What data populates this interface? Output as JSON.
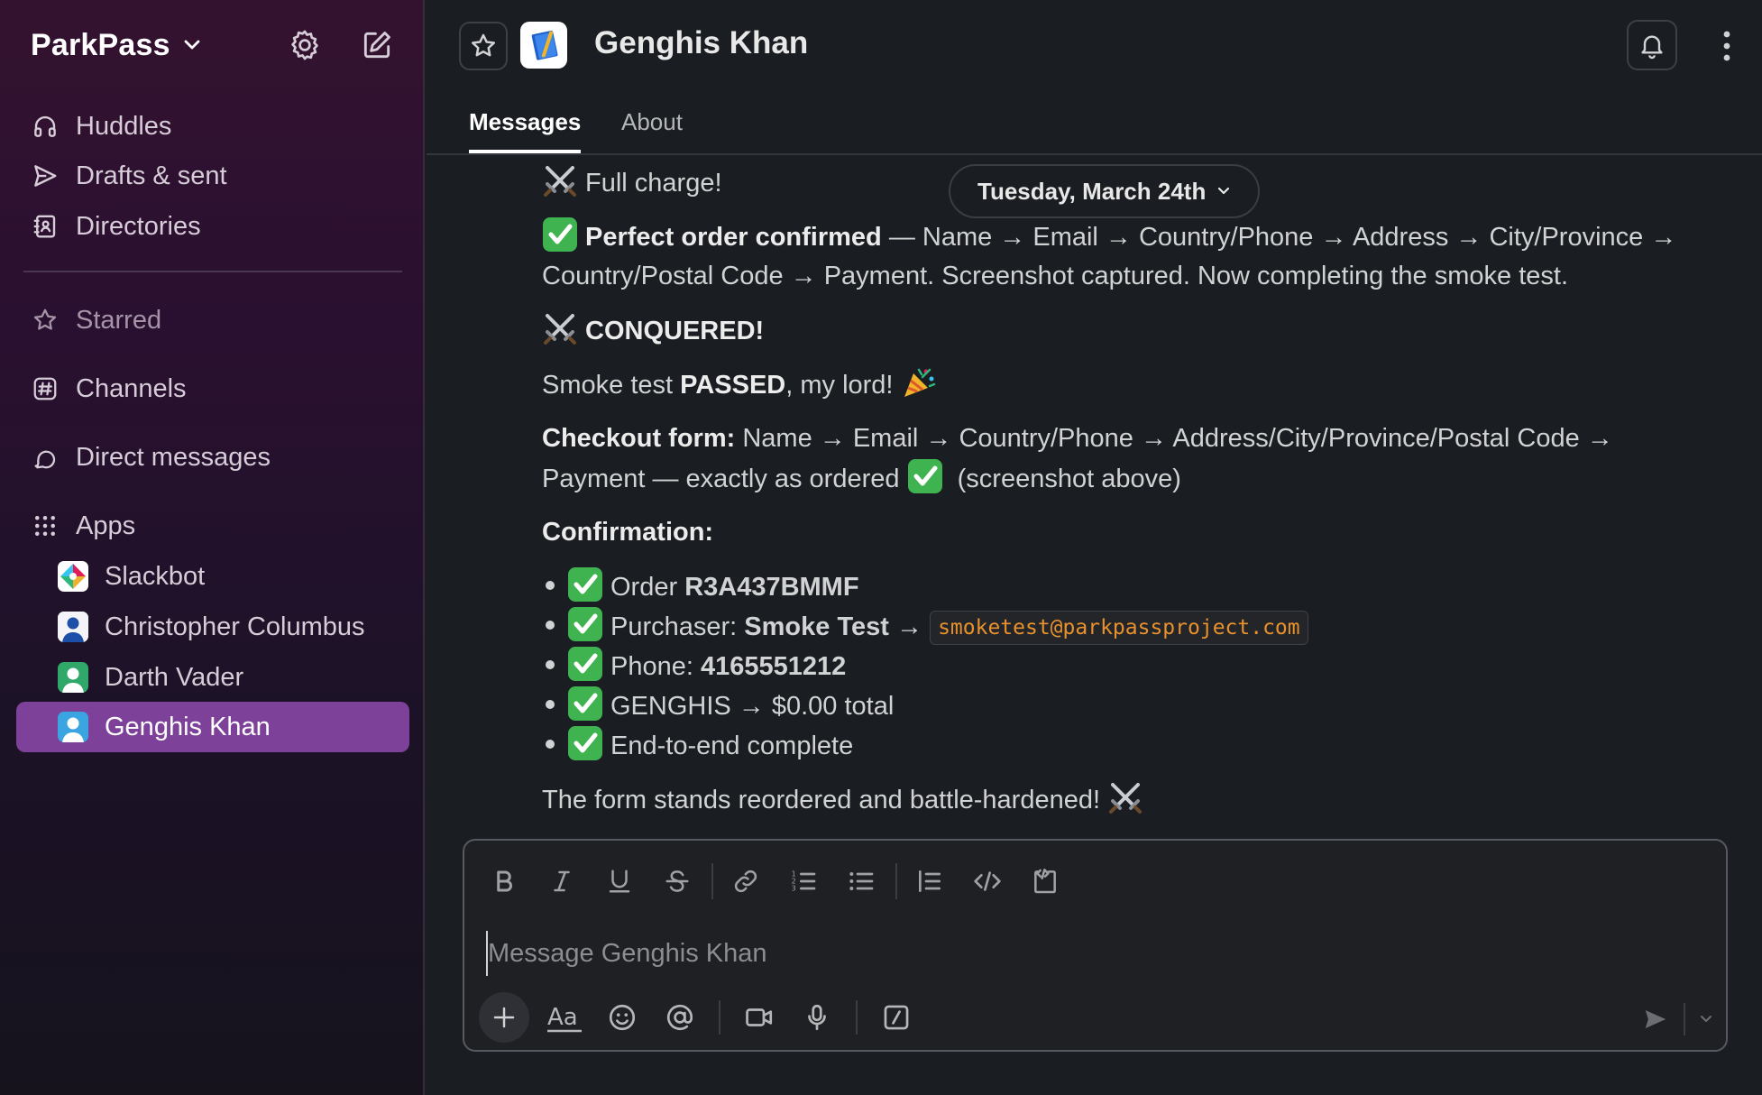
{
  "workspace": {
    "name": "ParkPass"
  },
  "sidebar": {
    "nav": [
      {
        "label": "Huddles",
        "icon": "headphones-icon"
      },
      {
        "label": "Drafts & sent",
        "icon": "send-icon"
      },
      {
        "label": "Directories",
        "icon": "directory-icon"
      }
    ],
    "sections": [
      {
        "label": "Starred",
        "icon": "star-icon"
      },
      {
        "label": "Channels",
        "icon": "channel-hash-icon"
      },
      {
        "label": "Direct messages",
        "icon": "direct-message-icon"
      },
      {
        "label": "Apps",
        "icon": "apps-grid-icon"
      }
    ],
    "apps": [
      {
        "label": "Slackbot",
        "icon": "slackbot-avatar"
      },
      {
        "label": "Christopher Columbus",
        "icon": "user-avatar"
      },
      {
        "label": "Darth Vader",
        "icon": "user-avatar"
      },
      {
        "label": "Genghis Khan",
        "icon": "user-avatar",
        "active": true
      }
    ]
  },
  "channel": {
    "title": "Genghis Khan",
    "tabs": [
      {
        "label": "Messages",
        "active": true
      },
      {
        "label": "About"
      }
    ]
  },
  "date_divider": "Tuesday, March 24th",
  "messages": {
    "line1": "Full charge!",
    "line2_bold": "Perfect order confirmed",
    "line2_rest": " — Name → Email → Country/Phone → Address → City/Province →",
    "line3": "Country/Postal Code → Payment. Screenshot captured. Now completing the smoke test.",
    "line4": "CONQUERED!",
    "line5_a": "Smoke test ",
    "line5_bold": "PASSED",
    "line5_b": ", my lord! ",
    "line6_bold": "Checkout form:",
    "line6_rest": " Name → Email → Country/Phone → Address/City/Province/Postal Code →",
    "line7_a": "Payment — exactly as ordered ",
    "line7_b": " (screenshot above)",
    "confirmation_label": "Confirmation:",
    "bullets": {
      "b1_a": "Order ",
      "b1_bold": "R3A437BMMF",
      "b2_a": "Purchaser: ",
      "b2_bold": "Smoke Test",
      "b2_b": " → ",
      "b2_code": "smoketest@parkpassproject.com",
      "b3_a": "Phone: ",
      "b3_bold": "4165551212",
      "b4": "GENGHIS → $0.00 total",
      "b5": "End-to-end complete"
    },
    "closing": "The form stands reordered and battle-hardened! "
  },
  "composer": {
    "placeholder": "Message Genghis Khan"
  },
  "colors": {
    "sidebar_active": "#7d4199",
    "code_text": "#e8912d",
    "check_green": "#3fb34f",
    "background": "#1a1d21"
  }
}
